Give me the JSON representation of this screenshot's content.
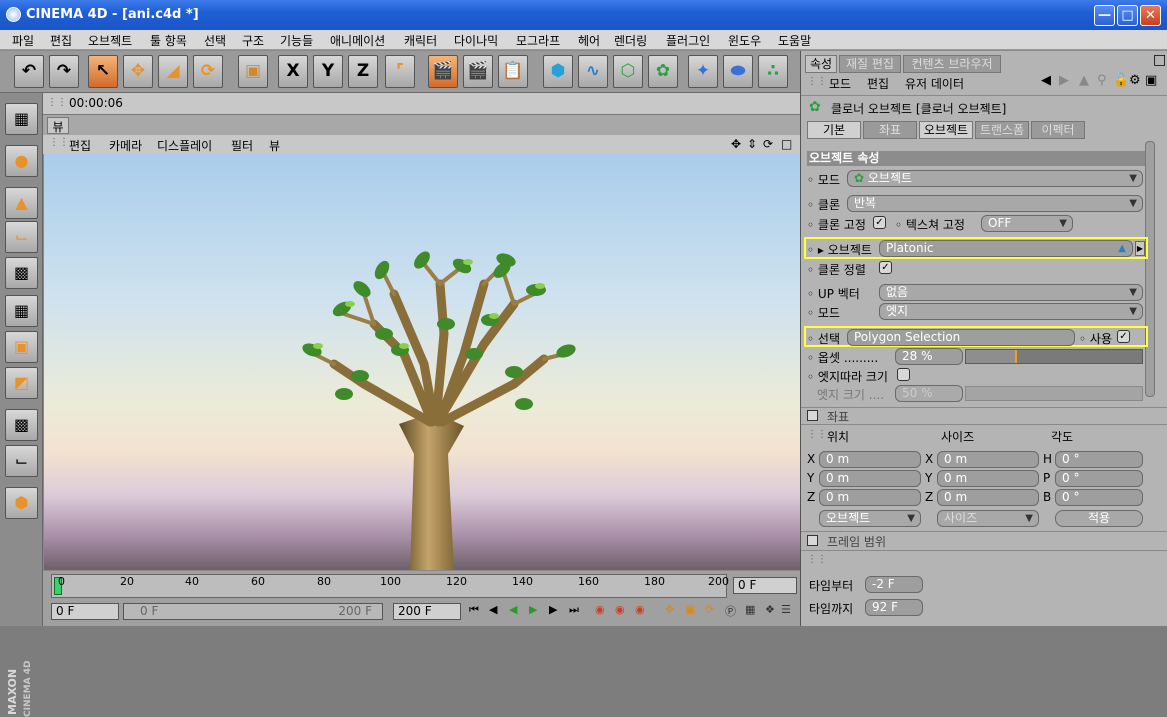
{
  "window": {
    "title": "CINEMA 4D - [ani.c4d *]",
    "controls": [
      "minimize",
      "maximize",
      "close"
    ]
  },
  "menu": [
    "파일",
    "편집",
    "오브젝트",
    "툴 항목",
    "선택",
    "구조",
    "기능들",
    "애니메이션",
    "캐릭터",
    "다이나믹",
    "모그라프",
    "헤어",
    "렌더링",
    "플러그인",
    "윈도우",
    "도움말"
  ],
  "toolbar": {
    "icons": [
      "undo-icon",
      "redo-icon",
      "live-select-icon",
      "move-icon",
      "scale-icon",
      "rotate-icon",
      "object-cube-icon",
      "x-axis-icon",
      "y-axis-icon",
      "z-axis-icon",
      "coord-system-icon",
      "render-view-icon",
      "render-picture-icon",
      "render-settings-icon",
      "primitive-cube-icon",
      "spline-icon",
      "nurbs-icon",
      "array-icon",
      "deformer-icon",
      "scene-icon",
      "particle-icon"
    ],
    "axis_labels": [
      "X",
      "Y",
      "Z"
    ]
  },
  "left_toolbar": {
    "icons": [
      "layout-icon",
      "scene-objects-icon",
      "model-icon",
      "axis-icon",
      "points-icon",
      "edges-icon",
      "polygons-icon",
      "uvw-icon",
      "texture-icon",
      "animation-icon",
      "primitives-icon"
    ]
  },
  "timecode": "00:00:06",
  "view": {
    "tab": "뷰",
    "menu": [
      "편집",
      "카메라",
      "디스플레이",
      "필터",
      "뷰"
    ]
  },
  "timeline": {
    "ticks": [
      "0",
      "20",
      "40",
      "60",
      "80",
      "100",
      "120",
      "140",
      "160",
      "180",
      "200"
    ],
    "current_frame": "0 F",
    "start_field": "0 F",
    "range_left": "0 F",
    "range_right": "200 F",
    "end_field": "200 F"
  },
  "attr": {
    "tabs": [
      "속성",
      "재질 편집",
      "컨텐츠 브라우저"
    ],
    "menu": [
      "모드",
      "편집",
      "유저 데이터"
    ],
    "header": "클로너 오브젝트 [클로너 오브젝트]",
    "subtabs": [
      "기본",
      "좌표",
      "오브젝트",
      "트랜스폼",
      "이펙터"
    ],
    "section": "오브젝트 속성",
    "mode_label": "모드",
    "mode_value": "오브젝트",
    "clone_label": "클론",
    "clone_value": "반복",
    "clone_fix_label": "클론 고정",
    "texture_fix_label": "텍스쳐 고정",
    "texture_fix_value": "OFF",
    "object_label": "오브젝트",
    "object_value": "Platonic",
    "clone_align_label": "클론 정렬",
    "up_vector_label": "UP 벡터",
    "up_vector_value": "없음",
    "mode2_label": "모드",
    "mode2_value": "엣지",
    "select_label": "선택",
    "select_value": "Polygon Selection",
    "use_label": "사용",
    "offset_label": "옵셋",
    "offset_value": "28 %",
    "offset_fraction": 0.28,
    "edge_size_label": "엣지따라 크기",
    "edge_size2_label": "엣지 크기",
    "edge_size2_value": "50 %"
  },
  "coords": {
    "title": "좌표",
    "col_position": "위치",
    "col_size": "사이즈",
    "col_angle": "각도",
    "pos": [
      {
        "axis": "X",
        "value": "0 m"
      },
      {
        "axis": "Y",
        "value": "0 m"
      },
      {
        "axis": "Z",
        "value": "0 m"
      }
    ],
    "size": [
      {
        "axis": "X",
        "value": "0 m"
      },
      {
        "axis": "Y",
        "value": "0 m"
      },
      {
        "axis": "Z",
        "value": "0 m"
      }
    ],
    "angle": [
      {
        "axis": "H",
        "value": "0 °"
      },
      {
        "axis": "P",
        "value": "0 °"
      },
      {
        "axis": "B",
        "value": "0 °"
      }
    ],
    "mode_select": "오브젝트",
    "size_select": "사이즈",
    "apply": "적용"
  },
  "frame_range": {
    "title": "프레임 범위",
    "from_label": "타임부터",
    "from_value": "-2 F",
    "to_label": "타임까지",
    "to_value": "92 F"
  }
}
